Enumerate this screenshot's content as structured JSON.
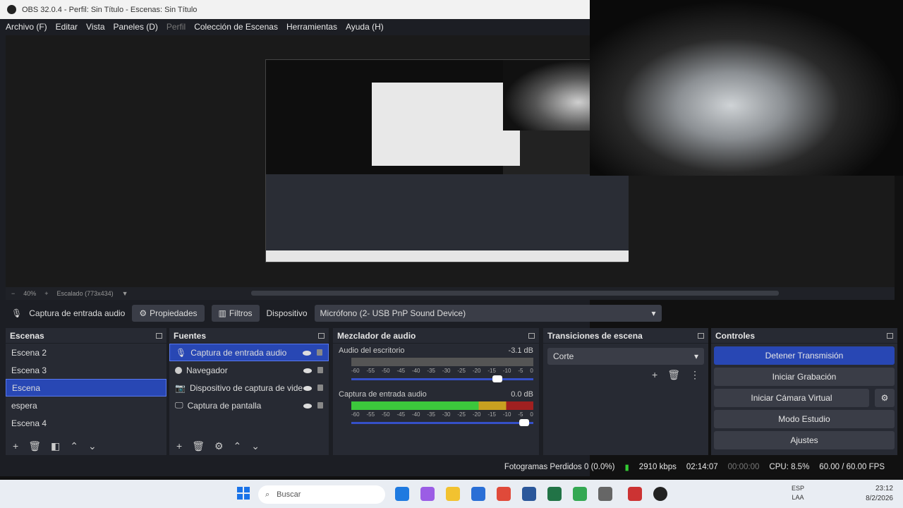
{
  "window": {
    "title": "OBS 32.0.4 - Perfil: Sin Título - Escenas: Sin Título"
  },
  "menu": [
    "Archivo (F)",
    "Editar",
    "Vista",
    "Paneles (D)",
    "Perfil",
    "Colección de Escenas",
    "Herramientas",
    "Ayuda (H)"
  ],
  "zoom": {
    "percent": "40%",
    "scale": "Escalado (773x434)"
  },
  "props": {
    "source_name": "Captura de entrada audio",
    "properties_label": "Propiedades",
    "filters_label": "Filtros",
    "device_label": "Dispositivo",
    "device_value": "Micrófono (2- USB PnP Sound Device)"
  },
  "scenes": {
    "title": "Escenas",
    "items": [
      "Escena 2",
      "Escena 3",
      "Escena",
      "espera",
      "Escena 4"
    ],
    "selected": "Escena"
  },
  "sources": {
    "title": "Fuentes",
    "items": [
      "Captura de entrada audio",
      "Navegador",
      "Dispositivo de captura de vide",
      "Captura de pantalla"
    ]
  },
  "mixer": {
    "title": "Mezclador de audio",
    "channels": [
      {
        "name": "Audio del escritorio",
        "db": "-3.1 dB",
        "level": 0
      },
      {
        "name": "Captura de entrada audio",
        "db": "0.0 dB",
        "level": 0.95
      }
    ],
    "scale": [
      "-60",
      "-55",
      "-50",
      "-45",
      "-40",
      "-35",
      "-30",
      "-25",
      "-20",
      "-15",
      "-10",
      "-5",
      "0"
    ]
  },
  "transitions": {
    "title": "Transiciones de escena",
    "value": "Corte"
  },
  "controls": {
    "title": "Controles",
    "buttons": [
      "Detener Transmisión",
      "Iniciar Grabación",
      "Iniciar Cámara Virtual",
      "Modo Estudio",
      "Ajustes"
    ]
  },
  "status": {
    "dropped": "Fotogramas Perdidos 0 (0.0%)",
    "kbps": "2910 kbps",
    "stream_time": "02:14:07",
    "rec_time": "00:00:00",
    "cpu": "CPU: 8.5%",
    "fps": "60.00 / 60.00 FPS"
  },
  "taskbar": {
    "search_placeholder": "Buscar",
    "lang": "ESP",
    "lang2": "LAA",
    "time": "23:12",
    "date": "8/2/2026"
  },
  "colors": {
    "accent": "#2847b4",
    "panel": "#272a33",
    "bg": "#1c1e24"
  }
}
